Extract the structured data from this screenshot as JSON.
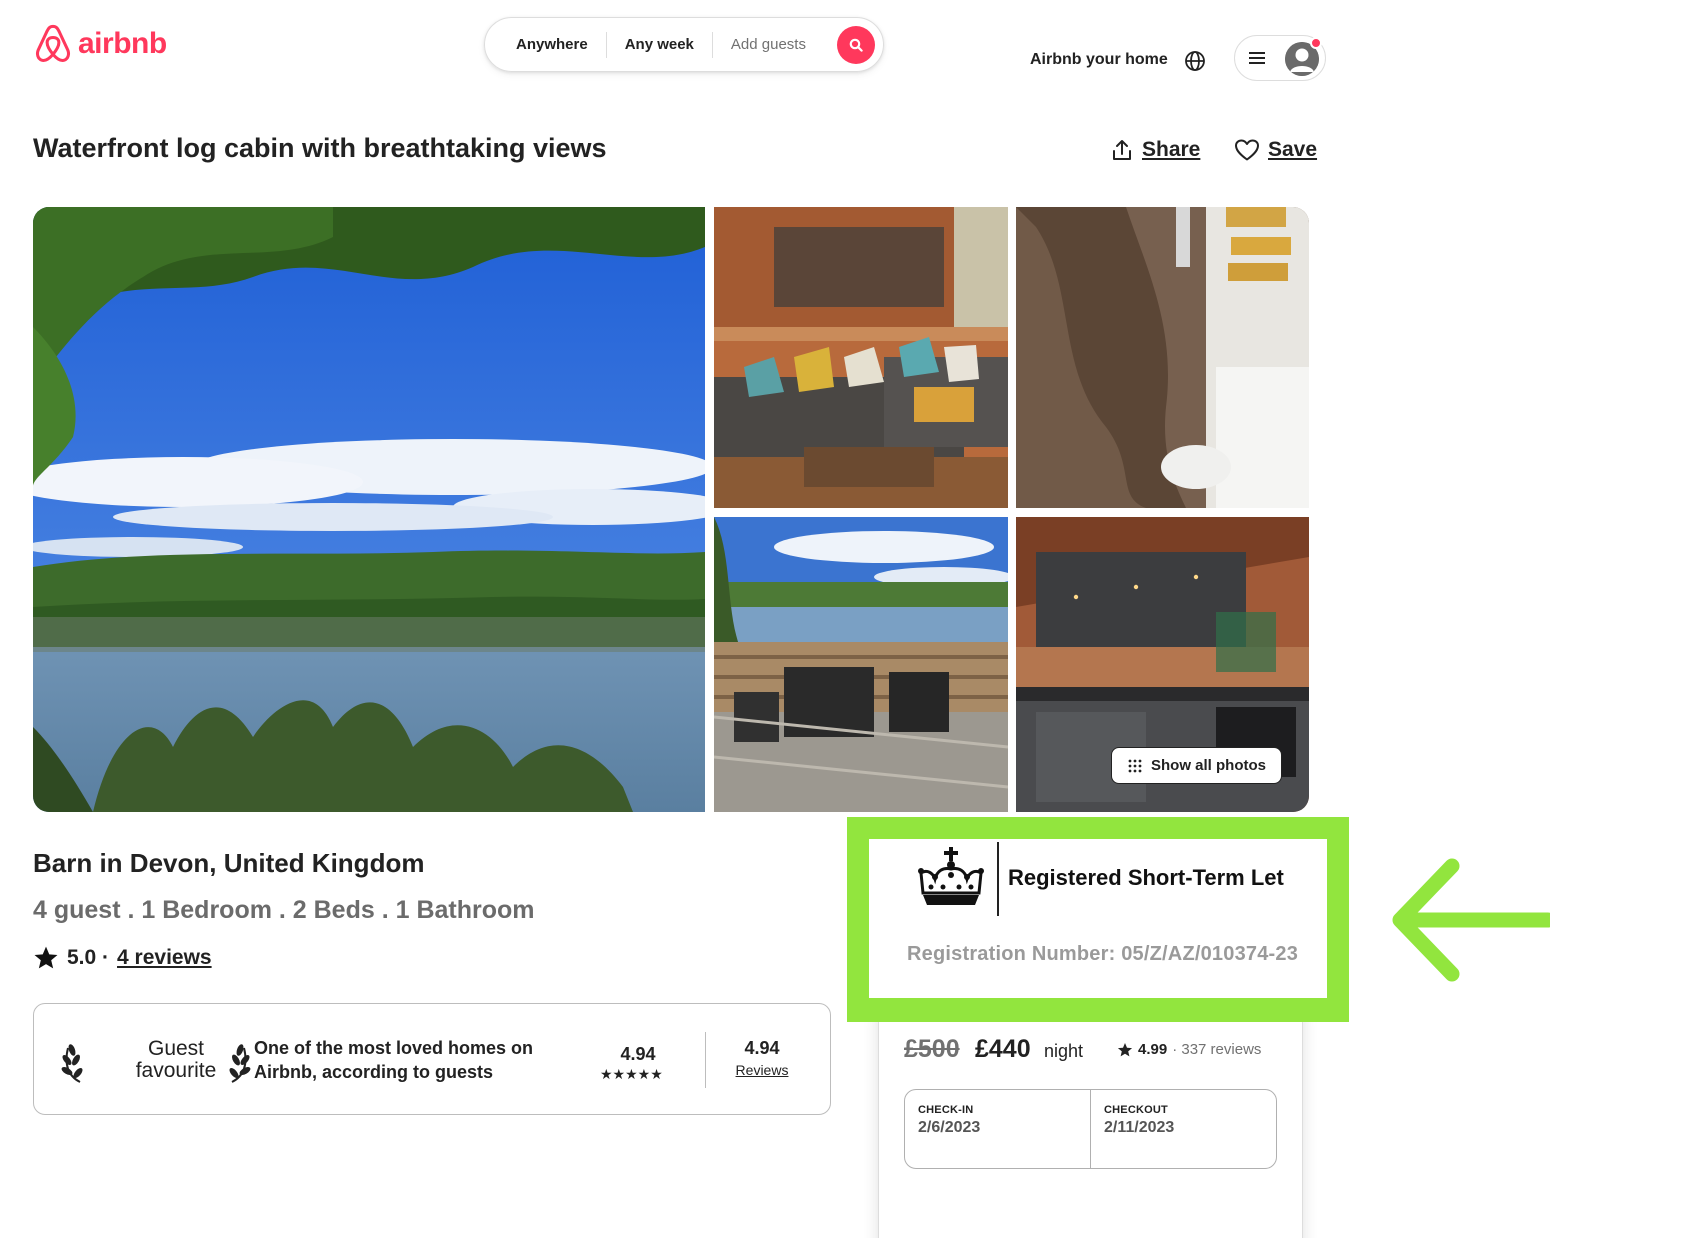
{
  "header": {
    "logo_text": "airbnb",
    "search": {
      "location": "Anywhere",
      "dates": "Any week",
      "guests_placeholder": "Add guests"
    },
    "host_link": "Airbnb your home"
  },
  "listing": {
    "title": "Waterfront log cabin with breathtaking views",
    "share_label": "Share",
    "save_label": "Save",
    "show_all_photos": "Show all photos",
    "subtitle": "Barn in Devon, United Kingdom",
    "specs": "4 guest . 1 Bedroom . 2 Beds . 1 Bathroom",
    "rating": "5.0 ·",
    "reviews_link": "4 reviews"
  },
  "guest_favourite": {
    "badge_line1": "Guest",
    "badge_line2": "favourite",
    "description": "One of the most loved homes on Airbnb, according to guests",
    "score": "4.94",
    "stars": "★★★★★",
    "score2": "4.94",
    "reviews_label": "Reviews"
  },
  "booking": {
    "old_price": "£500",
    "price": "£440",
    "unit": "night",
    "rating": "4.99",
    "reviews": "· 337 reviews",
    "checkin_label": "CHECK-IN",
    "checkin_value": "2/6/2023",
    "checkout_label": "CHECKOUT",
    "checkout_value": "2/11/2023"
  },
  "registration": {
    "title": "Registered Short-Term Let",
    "number": "Registration Number: 05/Z/AZ/010374-23"
  },
  "colors": {
    "brand": "#FF385C",
    "highlight": "#92E53E",
    "text": "#222222",
    "muted": "#717171"
  },
  "icons": [
    "airbnb-logo-icon",
    "search-icon",
    "globe-icon",
    "hamburger-icon",
    "user-avatar-icon",
    "share-icon",
    "heart-icon",
    "grid-dots-icon",
    "star-icon",
    "laurel-icon",
    "crown-icon",
    "arrow-left-icon"
  ]
}
